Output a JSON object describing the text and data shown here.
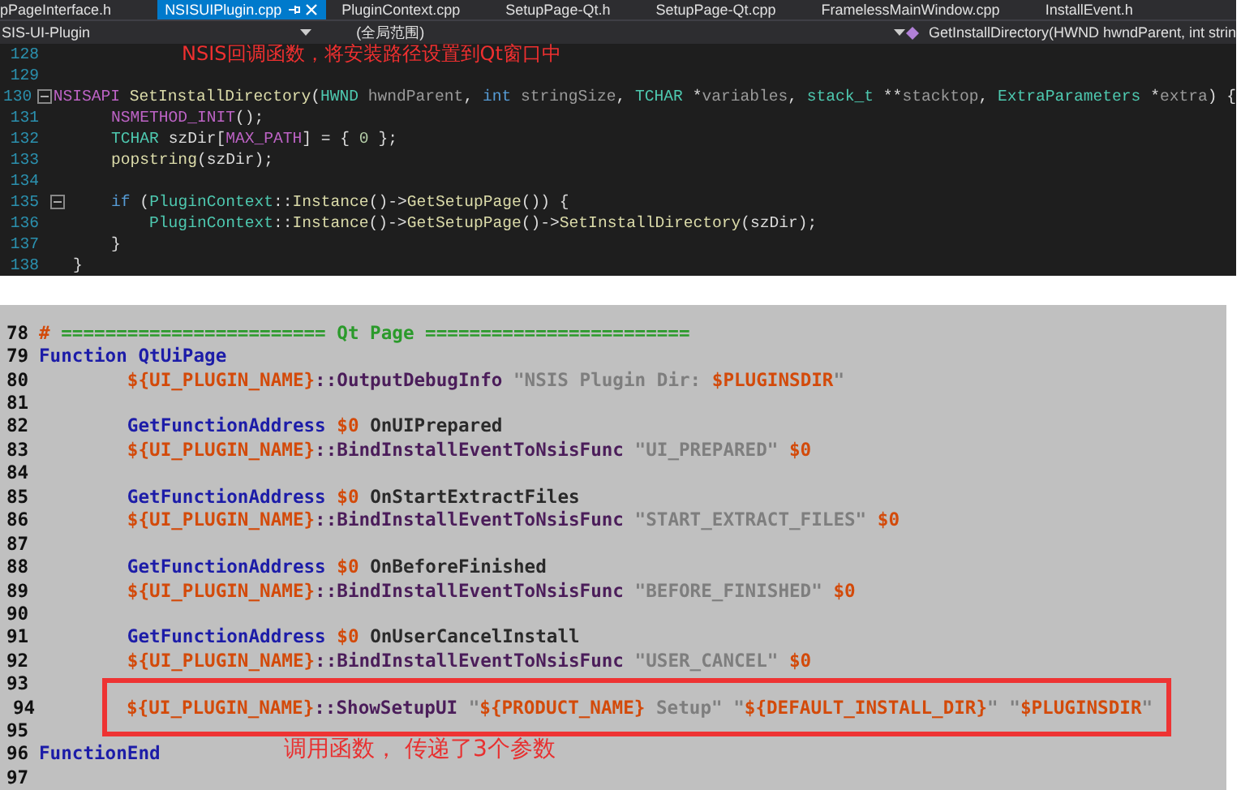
{
  "editor_tabs": [
    {
      "label": "pPageInterface.h",
      "selected": false
    },
    {
      "label": "NSISUIPlugin.cpp",
      "selected": true
    },
    {
      "label": "PluginContext.cpp",
      "selected": false
    },
    {
      "label": "SetupPage-Qt.h",
      "selected": false
    },
    {
      "label": "SetupPage-Qt.cpp",
      "selected": false
    },
    {
      "label": "FramelessMainWindow.cpp",
      "selected": false
    },
    {
      "label": "InstallEvent.h",
      "selected": false
    }
  ],
  "navigation_bar": {
    "project": "SIS-UI-Plugin",
    "scope": "(全局范围)",
    "member": "GetInstallDirectory(HWND hwndParent, int strin"
  },
  "cpp_editor": {
    "lines": [
      {
        "number": "128",
        "fold": false,
        "note": "NSIS回调函数，将安装路径设置到Qt窗口中"
      },
      {
        "number": "129",
        "fold": false
      },
      {
        "number": "130",
        "fold": true,
        "tokens": [
          {
            "text": "NSISAPI",
            "kind": "macro"
          },
          {
            "text": " SetInstallDirectory",
            "kind": "function"
          },
          {
            "text": "(",
            "kind": "plain"
          },
          {
            "text": "HWND",
            "kind": "type"
          },
          {
            "text": " hwndParent",
            "kind": "param"
          },
          {
            "text": ", ",
            "kind": "plain"
          },
          {
            "text": "int",
            "kind": "keyword"
          },
          {
            "text": " stringSize",
            "kind": "param"
          },
          {
            "text": ", ",
            "kind": "plain"
          },
          {
            "text": "TCHAR",
            "kind": "type"
          },
          {
            "text": " *",
            "kind": "plain"
          },
          {
            "text": "variables",
            "kind": "param"
          },
          {
            "text": ", ",
            "kind": "plain"
          },
          {
            "text": "stack_t",
            "kind": "type"
          },
          {
            "text": " **",
            "kind": "plain"
          },
          {
            "text": "stacktop",
            "kind": "param"
          },
          {
            "text": ", ",
            "kind": "plain"
          },
          {
            "text": "ExtraParameters",
            "kind": "type"
          },
          {
            "text": " *",
            "kind": "plain"
          },
          {
            "text": "extra",
            "kind": "param"
          },
          {
            "text": ") {",
            "kind": "plain"
          }
        ]
      },
      {
        "number": "131",
        "fold": false,
        "tokens": [
          {
            "text": "    NSMETHOD_INIT",
            "kind": "macro"
          },
          {
            "text": "();",
            "kind": "plain"
          }
        ]
      },
      {
        "number": "132",
        "fold": false,
        "tokens": [
          {
            "text": "    TCHAR",
            "kind": "type"
          },
          {
            "text": " szDir[",
            "kind": "plain"
          },
          {
            "text": "MAX_PATH",
            "kind": "macro"
          },
          {
            "text": "] = { ",
            "kind": "plain"
          },
          {
            "text": "0",
            "kind": "number"
          },
          {
            "text": " };",
            "kind": "plain"
          }
        ]
      },
      {
        "number": "133",
        "fold": false,
        "tokens": [
          {
            "text": "    popstring",
            "kind": "function"
          },
          {
            "text": "(szDir);",
            "kind": "plain"
          }
        ]
      },
      {
        "number": "134",
        "fold": false
      },
      {
        "number": "135",
        "fold": true,
        "tokens": [
          {
            "text": "    if",
            "kind": "keyword"
          },
          {
            "text": " (",
            "kind": "plain"
          },
          {
            "text": "PluginContext",
            "kind": "type"
          },
          {
            "text": "::",
            "kind": "plain"
          },
          {
            "text": "Instance",
            "kind": "function"
          },
          {
            "text": "()->",
            "kind": "plain"
          },
          {
            "text": "GetSetupPage",
            "kind": "function"
          },
          {
            "text": "()) {",
            "kind": "plain"
          }
        ]
      },
      {
        "number": "136",
        "fold": false,
        "tokens": [
          {
            "text": "        PluginContext",
            "kind": "type"
          },
          {
            "text": "::",
            "kind": "plain"
          },
          {
            "text": "Instance",
            "kind": "function"
          },
          {
            "text": "()->",
            "kind": "plain"
          },
          {
            "text": "GetSetupPage",
            "kind": "function"
          },
          {
            "text": "()->",
            "kind": "plain"
          },
          {
            "text": "SetInstallDirectory",
            "kind": "function"
          },
          {
            "text": "(szDir);",
            "kind": "plain"
          }
        ]
      },
      {
        "number": "137",
        "fold": false,
        "tokens": [
          {
            "text": "    }",
            "kind": "plain"
          }
        ]
      },
      {
        "number": "138",
        "fold": false,
        "tokens": [
          {
            "text": "}",
            "kind": "plain"
          }
        ]
      }
    ]
  },
  "nsis_editor": {
    "lines": [
      {
        "number": "78",
        "highlighted": false,
        "tokens": [
          {
            "text": "#",
            "kind": "variable"
          },
          {
            "text": " ======================== Qt Page ========================",
            "kind": "comment"
          }
        ]
      },
      {
        "number": "79",
        "highlighted": false,
        "tokens": [
          {
            "text": "Function",
            "kind": "keyword"
          },
          {
            "text": " QtUiPage",
            "kind": "keyword"
          }
        ]
      },
      {
        "number": "80",
        "highlighted": false,
        "tokens": [
          {
            "text": "        ${UI_PLUGIN_NAME}",
            "kind": "variable"
          },
          {
            "text": "::OutputDebugInfo",
            "kind": "call"
          },
          {
            "text": " \"NSIS Plugin Dir: ",
            "kind": "string"
          },
          {
            "text": "$PLUGINSDIR",
            "kind": "variable"
          },
          {
            "text": "\"",
            "kind": "string"
          }
        ]
      },
      {
        "number": "81",
        "highlighted": false
      },
      {
        "number": "82",
        "highlighted": false,
        "tokens": [
          {
            "text": "        GetFunctionAddress",
            "kind": "keyword"
          },
          {
            "text": " $0",
            "kind": "variable"
          },
          {
            "text": " OnUIPrepared",
            "kind": "plain"
          }
        ]
      },
      {
        "number": "83",
        "highlighted": false,
        "tokens": [
          {
            "text": "        ${UI_PLUGIN_NAME}",
            "kind": "variable"
          },
          {
            "text": "::BindInstallEventToNsisFunc",
            "kind": "call"
          },
          {
            "text": " \"UI_PREPARED\"",
            "kind": "string"
          },
          {
            "text": " $0",
            "kind": "variable"
          }
        ]
      },
      {
        "number": "84",
        "highlighted": false
      },
      {
        "number": "85",
        "highlighted": false,
        "tokens": [
          {
            "text": "        GetFunctionAddress",
            "kind": "keyword"
          },
          {
            "text": " $0",
            "kind": "variable"
          },
          {
            "text": " OnStartExtractFiles",
            "kind": "plain"
          }
        ]
      },
      {
        "number": "86",
        "highlighted": false,
        "tokens": [
          {
            "text": "        ${UI_PLUGIN_NAME}",
            "kind": "variable"
          },
          {
            "text": "::BindInstallEventToNsisFunc",
            "kind": "call"
          },
          {
            "text": " \"START_EXTRACT_FILES\"",
            "kind": "string"
          },
          {
            "text": " $0",
            "kind": "variable"
          }
        ]
      },
      {
        "number": "87",
        "highlighted": false
      },
      {
        "number": "88",
        "highlighted": false,
        "tokens": [
          {
            "text": "        GetFunctionAddress",
            "kind": "keyword"
          },
          {
            "text": " $0",
            "kind": "variable"
          },
          {
            "text": " OnBeforeFinished",
            "kind": "plain"
          }
        ]
      },
      {
        "number": "89",
        "highlighted": false,
        "tokens": [
          {
            "text": "        ${UI_PLUGIN_NAME}",
            "kind": "variable"
          },
          {
            "text": "::BindInstallEventToNsisFunc",
            "kind": "call"
          },
          {
            "text": " \"BEFORE_FINISHED\"",
            "kind": "string"
          },
          {
            "text": " $0",
            "kind": "variable"
          }
        ]
      },
      {
        "number": "90",
        "highlighted": false
      },
      {
        "number": "91",
        "highlighted": false,
        "tokens": [
          {
            "text": "        GetFunctionAddress",
            "kind": "keyword"
          },
          {
            "text": " $0",
            "kind": "variable"
          },
          {
            "text": " OnUserCancelInstall",
            "kind": "plain"
          }
        ]
      },
      {
        "number": "92",
        "highlighted": false,
        "tokens": [
          {
            "text": "        ${UI_PLUGIN_NAME}",
            "kind": "variable"
          },
          {
            "text": "::BindInstallEventToNsisFunc",
            "kind": "call"
          },
          {
            "text": " \"USER_CANCEL\"",
            "kind": "string"
          },
          {
            "text": " $0",
            "kind": "variable"
          }
        ]
      },
      {
        "number": "93",
        "highlighted": false
      },
      {
        "number": "94",
        "highlighted": true,
        "tokens": [
          {
            "text": "        ${UI_PLUGIN_NAME}",
            "kind": "variable"
          },
          {
            "text": "::ShowSetupUI",
            "kind": "call"
          },
          {
            "text": " \"",
            "kind": "string"
          },
          {
            "text": "${PRODUCT_NAME}",
            "kind": "variable"
          },
          {
            "text": " Setup\" \"",
            "kind": "string"
          },
          {
            "text": "${DEFAULT_INSTALL_DIR}",
            "kind": "variable"
          },
          {
            "text": "\" \"",
            "kind": "string"
          },
          {
            "text": "$PLUGINSDIR",
            "kind": "variable"
          },
          {
            "text": "\"",
            "kind": "string"
          }
        ]
      },
      {
        "number": "95",
        "highlighted": false
      },
      {
        "number": "96",
        "highlighted": false,
        "note": "调用函数， 传递了3个参数",
        "tokens": [
          {
            "text": "FunctionEnd",
            "kind": "keyword"
          }
        ]
      },
      {
        "number": "97",
        "highlighted": false
      }
    ]
  }
}
